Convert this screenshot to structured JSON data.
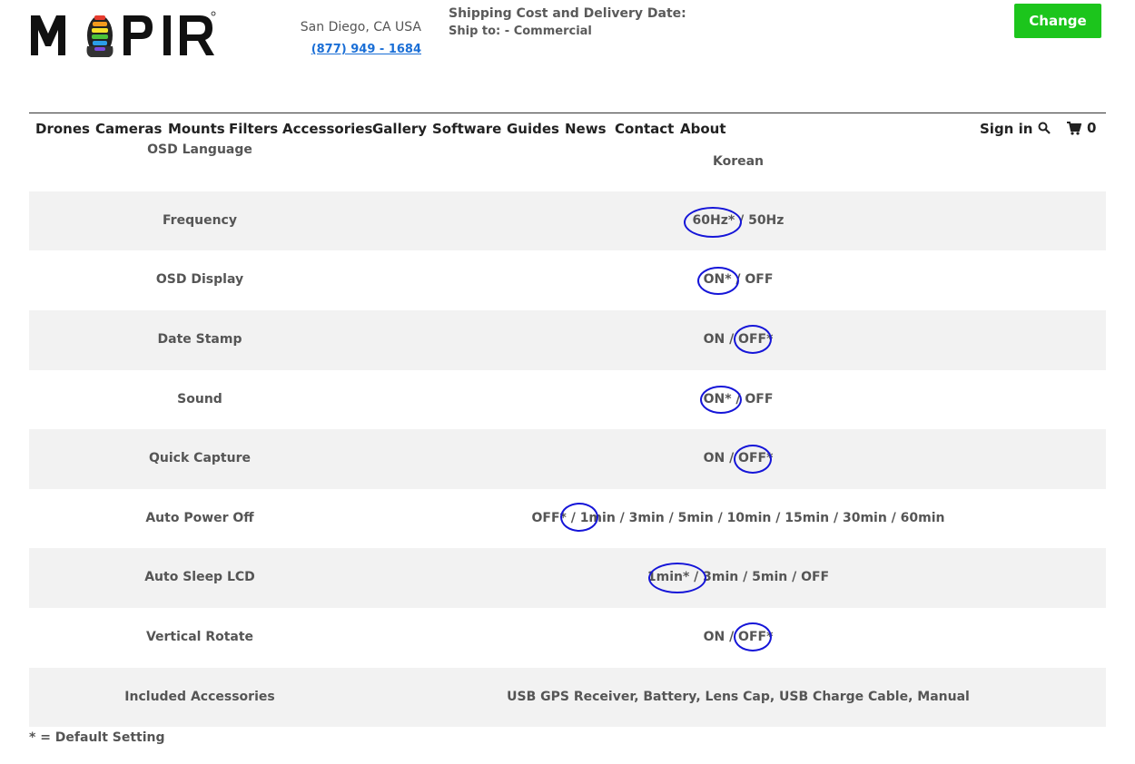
{
  "header": {
    "logo_text": "MAPIR",
    "location": "San Diego, CA USA",
    "phone": "(877) 949 - 1684",
    "shipping_title": "Shipping Cost and Delivery Date:",
    "ship_to": "Ship to: - Commercial",
    "change_label": "Change"
  },
  "nav": {
    "items": [
      "Drones",
      "Cameras",
      "Mounts",
      "Filters",
      "Accessories",
      "Gallery",
      "Software",
      "Guides",
      "News",
      "Contact",
      "About"
    ],
    "sign_in": "Sign in",
    "cart_count": "0"
  },
  "table": {
    "rows": [
      {
        "label": "OSD Language",
        "value": "Korean"
      },
      {
        "label": "Frequency",
        "value": "60Hz* / 50Hz"
      },
      {
        "label": "OSD Display",
        "value": "ON* / OFF"
      },
      {
        "label": "Date Stamp",
        "value": "ON / OFF*"
      },
      {
        "label": "Sound",
        "value": "ON* / OFF"
      },
      {
        "label": "Quick Capture",
        "value": "ON / OFF*"
      },
      {
        "label": "Auto Power Off",
        "value": "OFF* / 1min / 3min / 5min / 10min / 15min / 30min / 60min"
      },
      {
        "label": "Auto Sleep LCD",
        "value": "1min* / 3min / 5min / OFF"
      },
      {
        "label": "Vertical Rotate",
        "value": "ON / OFF*"
      },
      {
        "label": "Included Accessories",
        "value": "USB GPS Receiver, Battery, Lens Cap, USB Charge Cable, Manual"
      }
    ]
  },
  "footnote": "* = Default Setting",
  "colors": {
    "accent_green": "#1cc51c",
    "link_blue": "#1b6fd6",
    "annotation_circle": "#1515d8",
    "row_shade": "#f2f2f2"
  }
}
